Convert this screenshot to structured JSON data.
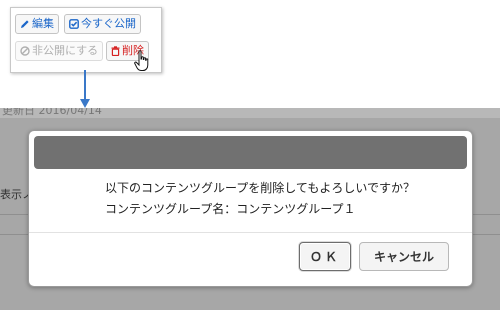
{
  "toolbar": {
    "edit_label": "編集",
    "publish_now_label": "今すぐ公開",
    "unpublish_label": "非公開にする",
    "delete_label": "削除"
  },
  "background": {
    "date_text": "更新日 2016/04/14 ",
    "side_label": "表示ノ"
  },
  "dialog": {
    "message_line1": "以下のコンテンツグループを削除してもよろしいですか？",
    "message_line2": "コンテンツグループ名：コンテンツグループ１",
    "ok_label": "ＯＫ",
    "cancel_label": "キャンセル"
  },
  "colors": {
    "link_blue": "#1b66c9",
    "danger_red": "#d62020",
    "arrow_blue": "#3a78c8",
    "dialog_titlebar": "#717171"
  },
  "icons": {
    "edit": "pencil-icon",
    "publish": "check-square-icon",
    "unpublish": "ban-icon",
    "delete": "trash-icon",
    "cursor": "hand-cursor-icon"
  }
}
